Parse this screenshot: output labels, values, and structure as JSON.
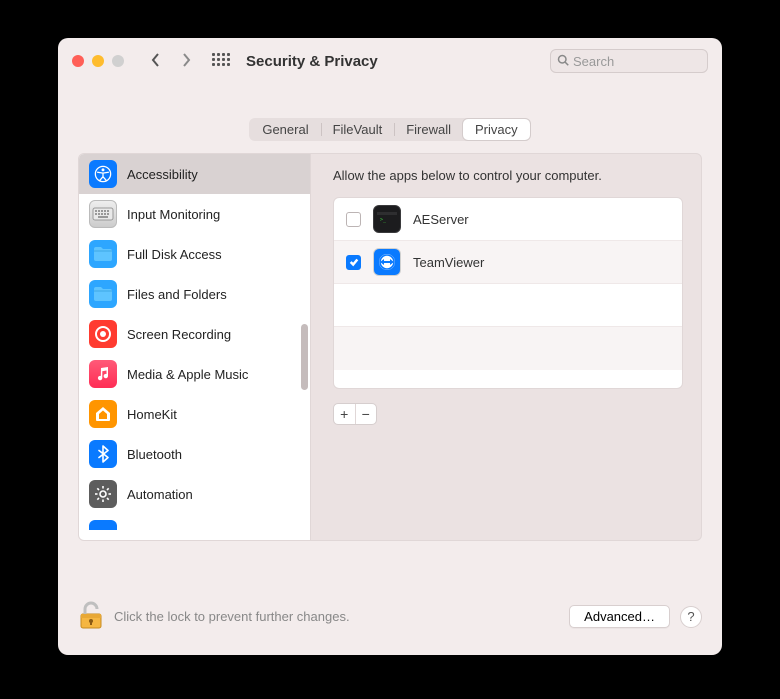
{
  "window": {
    "title": "Security & Privacy",
    "search_placeholder": "Search"
  },
  "tabs": [
    {
      "label": "General"
    },
    {
      "label": "FileVault"
    },
    {
      "label": "Firewall"
    },
    {
      "label": "Privacy",
      "active": true
    }
  ],
  "sidebar": {
    "items": [
      {
        "label": "Accessibility",
        "icon": "accessibility"
      },
      {
        "label": "Input Monitoring",
        "icon": "keyboard"
      },
      {
        "label": "Full Disk Access",
        "icon": "folder"
      },
      {
        "label": "Files and Folders",
        "icon": "folder"
      },
      {
        "label": "Screen Recording",
        "icon": "record"
      },
      {
        "label": "Media & Apple Music",
        "icon": "music"
      },
      {
        "label": "HomeKit",
        "icon": "home"
      },
      {
        "label": "Bluetooth",
        "icon": "bluetooth"
      },
      {
        "label": "Automation",
        "icon": "gear"
      }
    ],
    "selected_index": 0
  },
  "content": {
    "prompt": "Allow the apps below to control your computer.",
    "apps": [
      {
        "name": "AEServer",
        "checked": false,
        "icon": "terminal"
      },
      {
        "name": "TeamViewer",
        "checked": true,
        "icon": "teamviewer"
      }
    ]
  },
  "footer": {
    "lock_text": "Click the lock to prevent further changes.",
    "advanced_label": "Advanced…",
    "help_label": "?"
  }
}
